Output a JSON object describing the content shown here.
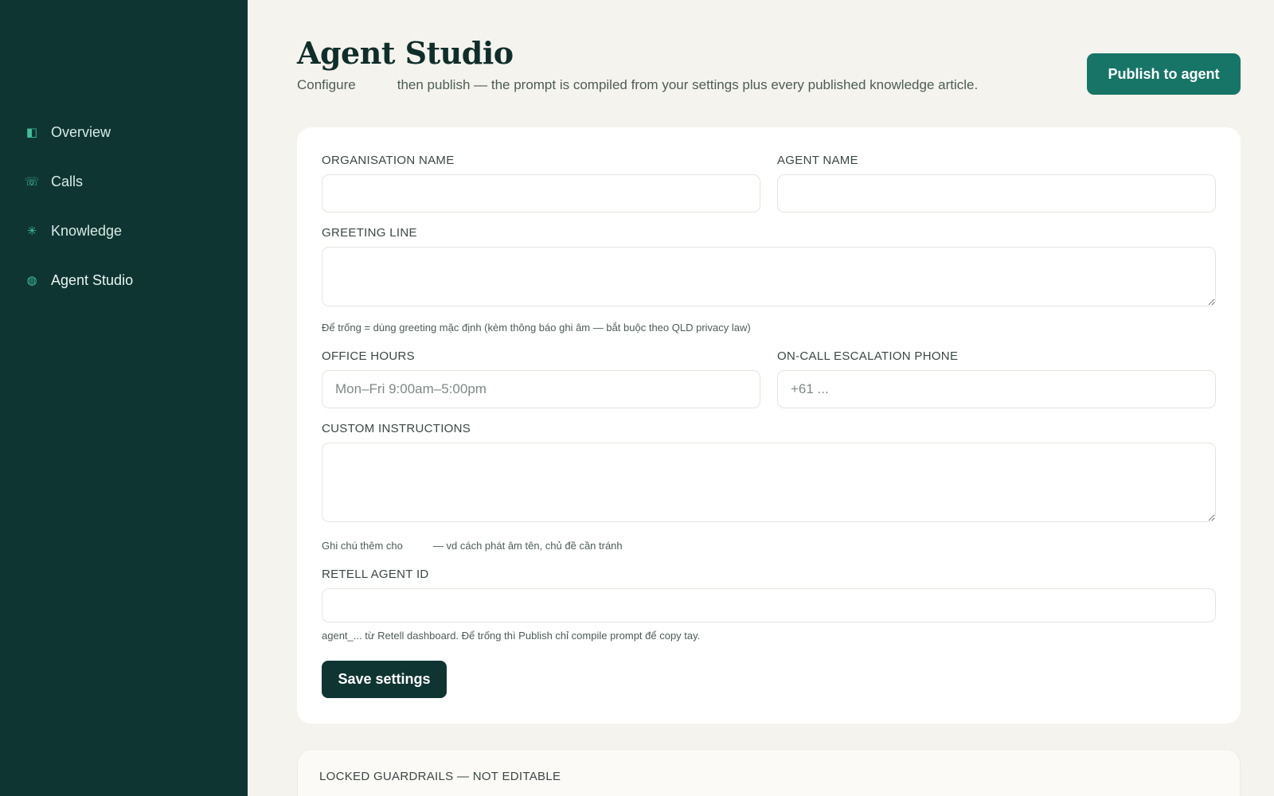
{
  "sidebar": {
    "items": [
      {
        "label": "Overview",
        "icon": "overview-icon",
        "glyph": "◧"
      },
      {
        "label": "Calls",
        "icon": "phone-icon",
        "glyph": "☏"
      },
      {
        "label": "Knowledge",
        "icon": "asterisk-icon",
        "glyph": "✳"
      },
      {
        "label": "Agent Studio",
        "icon": "globe-icon",
        "glyph": "◍"
      }
    ]
  },
  "header": {
    "title": "Agent Studio",
    "subtitle_part1": "Configure",
    "subtitle_part2": "then publish — the prompt is compiled from your settings plus every published knowledge article.",
    "publish_label": "Publish to agent"
  },
  "form": {
    "org_name_label": "ORGANISATION NAME",
    "org_name_value": "",
    "agent_name_label": "AGENT NAME",
    "agent_name_value": "",
    "greeting_label": "GREETING LINE",
    "greeting_value": "",
    "greeting_hint": "Để trống = dùng greeting mặc định (kèm thông báo ghi âm — bắt buộc theo QLD privacy law)",
    "office_hours_label": "OFFICE HOURS",
    "office_hours_placeholder": "Mon–Fri 9:00am–5:00pm",
    "escalation_label": "ON-CALL ESCALATION PHONE",
    "escalation_placeholder": "+61 ...",
    "custom_label": "CUSTOM INSTRUCTIONS",
    "custom_value": "",
    "custom_hint_part1": "Ghi chú thêm cho",
    "custom_hint_part2": "— vd cách phát âm tên, chủ đề cần tránh",
    "retell_label": "RETELL AGENT ID",
    "retell_value": "",
    "retell_hint": "agent_... từ Retell dashboard. Để trống thì Publish chỉ compile prompt để copy tay.",
    "save_label": "Save settings"
  },
  "guardrails": {
    "title": "LOCKED GUARDRAILS — NOT EDITABLE"
  },
  "colors": {
    "sidebar_bg": "#0f3532",
    "accent": "#177567",
    "page_bg": "#f5f3ee"
  }
}
